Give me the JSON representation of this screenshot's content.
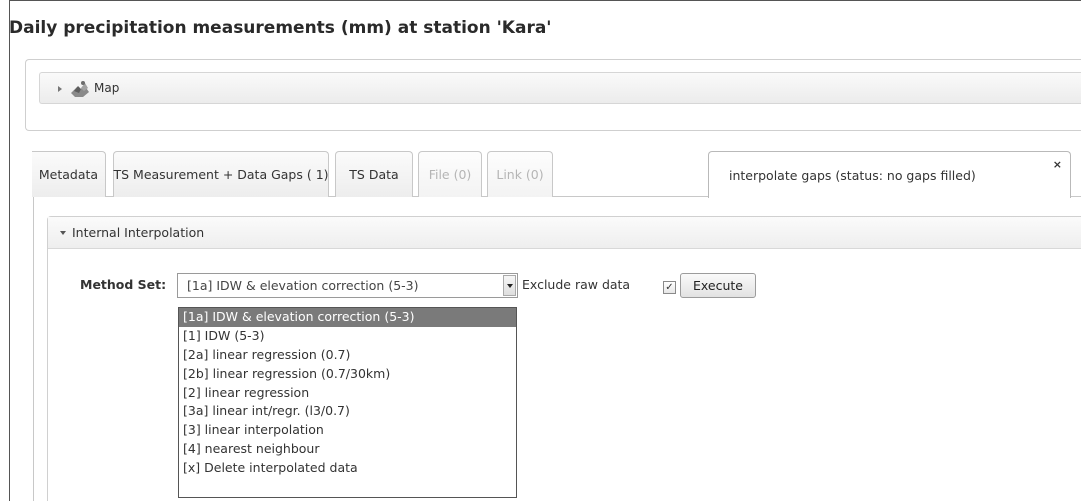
{
  "page": {
    "title": "Daily precipitation measurements (mm) at station 'Kara'"
  },
  "map_panel": {
    "label": "Map",
    "icon": "map-icon"
  },
  "tabs": [
    {
      "label": "Metadata",
      "state": "normal"
    },
    {
      "label": "TS Measurement + Data Gaps ( 1)",
      "state": "normal"
    },
    {
      "label": "TS Data",
      "state": "normal"
    },
    {
      "label": "File (0)",
      "state": "disabled"
    },
    {
      "label": "Link (0)",
      "state": "disabled"
    },
    {
      "label": "interpolate gaps (status: no gaps filled)",
      "state": "active",
      "close": "×"
    }
  ],
  "interpolation": {
    "section_label": "Internal Interpolation",
    "method_label": "Method Set:",
    "selected_value": "[1a] IDW & elevation correction (5-3)",
    "exclude_label": "Exclude raw data",
    "exclude_checked": "✓",
    "execute_label": "Execute",
    "options": [
      "[1a] IDW & elevation correction (5-3)",
      "[1] IDW (5-3)",
      "[2a] linear regression (0.7)",
      "[2b] linear regression (0.7/30km)",
      "[2] linear regression",
      "[3a] linear int/regr. (l3/0.7)",
      "[3] linear interpolation",
      "[4] nearest neighbour",
      "[x] Delete interpolated data"
    ],
    "selected_option_index": 0
  },
  "colors": {
    "selected_option_bg": "#7a7a7a",
    "disabled_tab_text": "#b5b5b5"
  }
}
